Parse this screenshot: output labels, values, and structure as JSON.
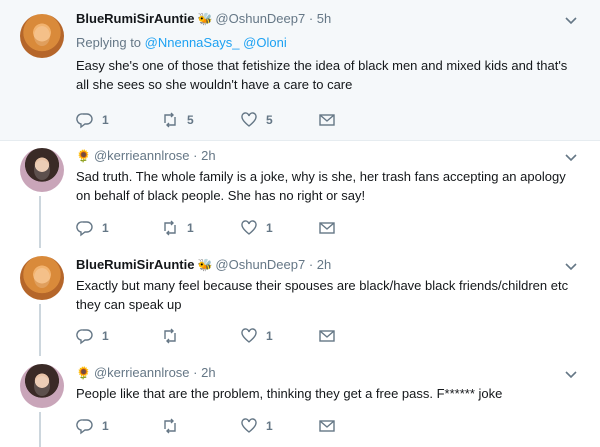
{
  "tweets": [
    {
      "name": "BlueRumiSirAuntie",
      "name_emoji": "🐝",
      "handle": "@OshunDeep7",
      "time": "· 5h",
      "replying_prefix": "Replying to",
      "replying_to": [
        "@NnennaSays_",
        "@Oloni"
      ],
      "text": "Easy she's one of those that fetishize the idea of black men and mixed kids and that's all she sees so she wouldn't have a care to care",
      "replies": "1",
      "retweets": "5",
      "likes": "5"
    },
    {
      "name": "",
      "name_emoji": "🌻",
      "handle": "@kerrieannlrose",
      "time": "· 2h",
      "text": "Sad truth. The whole family is a joke, why is she, her trash fans accepting an apology on behalf of black people. She has no right or say!",
      "replies": "1",
      "retweets": "1",
      "likes": "1"
    },
    {
      "name": "BlueRumiSirAuntie",
      "name_emoji": "🐝",
      "handle": "@OshunDeep7",
      "time": "· 2h",
      "text": "Exactly but many feel because their spouses are black/have black friends/children etc they can speak up",
      "replies": "1",
      "retweets": "",
      "likes": "1"
    },
    {
      "name": "",
      "name_emoji": "🌻",
      "handle": "@kerrieannlrose",
      "time": "· 2h",
      "text": "People like that are the problem, thinking they get a free pass. F****** joke",
      "replies": "1",
      "retweets": "",
      "likes": "1"
    }
  ],
  "colors": {
    "accent": "#1da1f2",
    "muted": "#657786",
    "focused_bg": "#f5f8fa"
  }
}
